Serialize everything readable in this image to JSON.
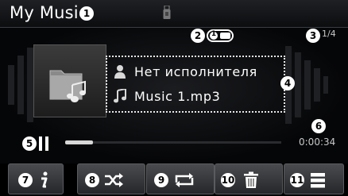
{
  "header": {
    "title": "My Music",
    "usb_icon": "usb-icon"
  },
  "callouts": {
    "c1": "1",
    "c2": "2",
    "c3": "3",
    "c4": "4",
    "c5": "5",
    "c6": "6",
    "c7": "7",
    "c8": "8",
    "c9": "9",
    "c10": "10",
    "c11": "11"
  },
  "status": {
    "track_position": "1/4",
    "repeat_badge": "1"
  },
  "now_playing": {
    "artist": "Нет исполнителя",
    "title": "Music 1.mp3",
    "elapsed": "0:00:34",
    "progress_fraction": 0.13
  },
  "buttons": [
    {
      "name": "info",
      "icon": "info-icon"
    },
    {
      "name": "shuffle",
      "icon": "shuffle-icon"
    },
    {
      "name": "repeat",
      "icon": "repeat-icon"
    },
    {
      "name": "delete",
      "icon": "trash-icon"
    },
    {
      "name": "list",
      "icon": "list-icon"
    }
  ],
  "colors": {
    "background": "#050608",
    "text": "#ffffff",
    "button": "#3a3b3e"
  }
}
